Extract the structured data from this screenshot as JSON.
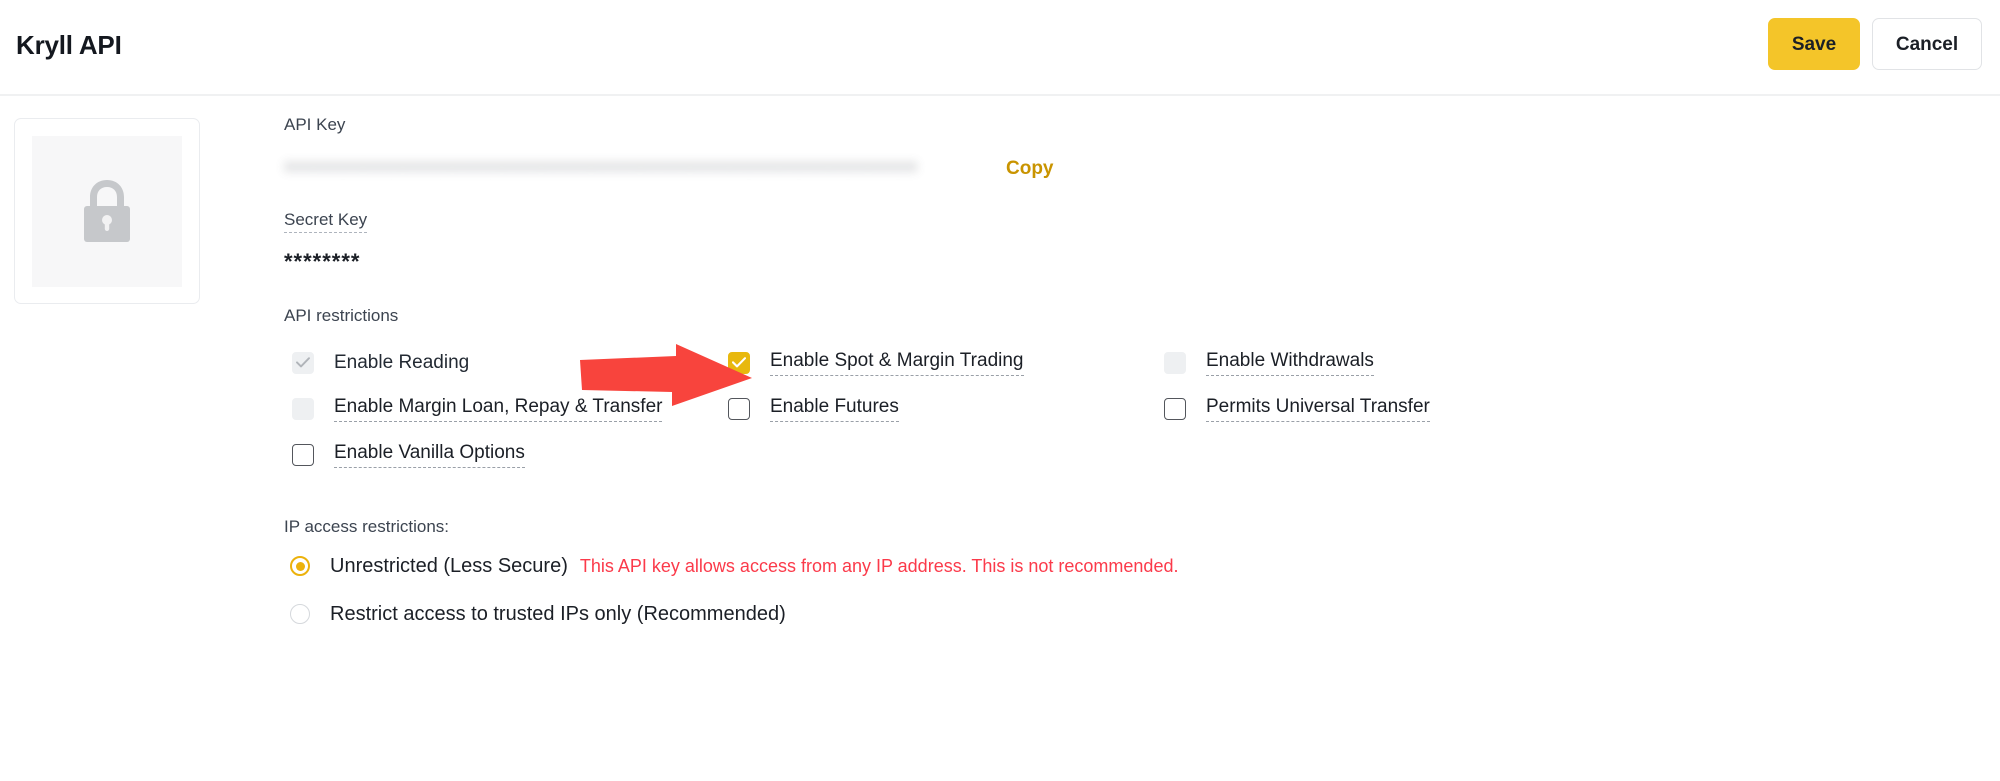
{
  "header": {
    "title": "Kryll API",
    "save_label": "Save",
    "cancel_label": "Cancel",
    "save_color": "#f4c529"
  },
  "icon_card": {
    "icon": "lock-icon"
  },
  "api_key": {
    "label": "API Key",
    "value_masked": "xxxxxxxxxxxxxxxxxxxxxxxxxxxxxxxxxxxxxxxxxxxxxxxxxxxxxxxxxxxxxxxx",
    "copy_label": "Copy",
    "copy_color": "#c99400"
  },
  "secret_key": {
    "label": "Secret Key",
    "value": "********"
  },
  "api_restrictions": {
    "label": "API restrictions",
    "items": [
      {
        "label": "Enable Reading",
        "state": "checked-disabled",
        "underline": false,
        "column": 1,
        "row": 1
      },
      {
        "label": "Enable Spot & Margin Trading",
        "state": "checked",
        "underline": true,
        "column": 2,
        "row": 1
      },
      {
        "label": "Enable Withdrawals",
        "state": "unchecked-disabled",
        "underline": true,
        "column": 3,
        "row": 1
      },
      {
        "label": "Enable Margin Loan, Repay & Transfer",
        "state": "unchecked-disabled",
        "underline": true,
        "column": 1,
        "row": 2
      },
      {
        "label": "Enable Futures",
        "state": "unchecked",
        "underline": true,
        "column": 2,
        "row": 2
      },
      {
        "label": "Permits Universal Transfer",
        "state": "unchecked",
        "underline": true,
        "column": 3,
        "row": 2
      },
      {
        "label": "Enable Vanilla Options",
        "state": "unchecked",
        "underline": true,
        "column": 1,
        "row": 3
      }
    ]
  },
  "ip_restrictions": {
    "label": "IP access restrictions:",
    "options": [
      {
        "label": "Unrestricted (Less Secure)",
        "selected": true,
        "warning": "This API key allows access from any IP address. This is not recommended."
      },
      {
        "label": "Restrict access to trusted IPs only (Recommended)",
        "selected": false,
        "warning": ""
      }
    ],
    "warning_color": "#fb3a4a"
  },
  "annotation": {
    "arrow": "red-arrow-pointing-right",
    "color": "#f8443d"
  }
}
